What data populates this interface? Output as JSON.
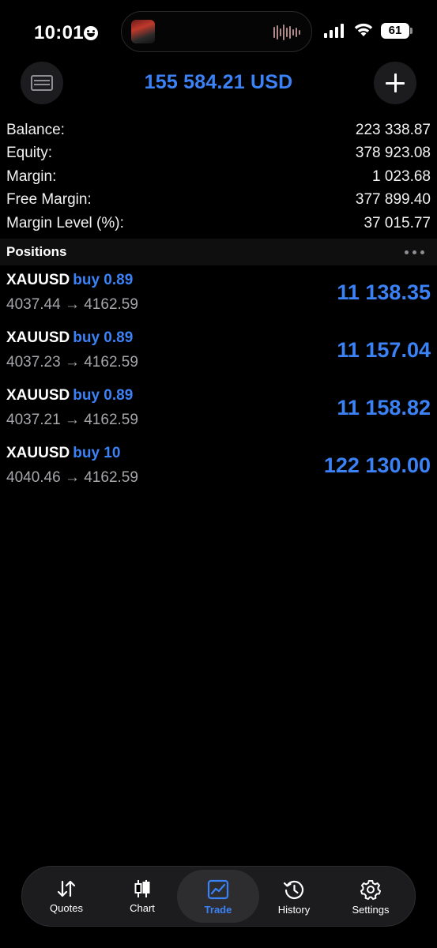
{
  "status_bar": {
    "time": "10:01",
    "battery": "61"
  },
  "header": {
    "total": "155 584.21 USD",
    "left_icon": "card-icon",
    "right_icon": "plus-icon"
  },
  "summary": [
    {
      "label": "Balance:",
      "value": "223 338.87"
    },
    {
      "label": "Equity:",
      "value": "378 923.08"
    },
    {
      "label": "Margin:",
      "value": "1 023.68"
    },
    {
      "label": "Free Margin:",
      "value": "377 899.40"
    },
    {
      "label": "Margin Level (%):",
      "value": "37 015.77"
    }
  ],
  "positions": {
    "title": "Positions",
    "items": [
      {
        "symbol": "XAUUSD",
        "side": "buy 0.89",
        "prices": "4037.44 → 4162.59",
        "profit": "11 138.35"
      },
      {
        "symbol": "XAUUSD",
        "side": "buy 0.89",
        "prices": "4037.23 → 4162.59",
        "profit": "11 157.04"
      },
      {
        "symbol": "XAUUSD",
        "side": "buy 0.89",
        "prices": "4037.21 → 4162.59",
        "profit": "11 158.82"
      },
      {
        "symbol": "XAUUSD",
        "side": "buy 10",
        "prices": "4040.46 → 4162.59",
        "profit": "122 130.00"
      }
    ]
  },
  "tabs": [
    {
      "label": "Quotes",
      "icon": "quotes-icon"
    },
    {
      "label": "Chart",
      "icon": "chart-icon"
    },
    {
      "label": "Trade",
      "icon": "trade-icon",
      "active": true
    },
    {
      "label": "History",
      "icon": "history-icon"
    },
    {
      "label": "Settings",
      "icon": "settings-icon"
    }
  ],
  "colors": {
    "accent": "#3b82f6",
    "background": "#000000",
    "surface": "#1c1c1e"
  }
}
